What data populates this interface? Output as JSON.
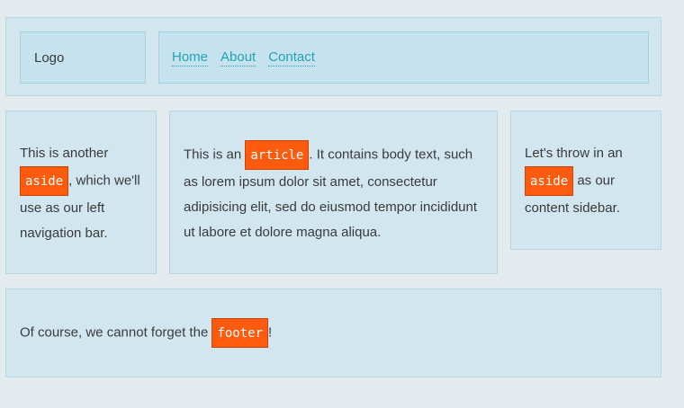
{
  "header": {
    "logo": "Logo",
    "nav": [
      {
        "label": "Home"
      },
      {
        "label": "About"
      },
      {
        "label": "Contact"
      }
    ]
  },
  "left_aside": {
    "text_before": "This is another ",
    "tag": "aside",
    "text_after": ", which we'll use as our left navigation bar."
  },
  "article": {
    "text_before": "This is an ",
    "tag": "article",
    "text_after": ". It contains body text, such as lorem ipsum dolor sit amet, consectetur adipisicing elit, sed do eiusmod tempor incididunt ut labore et dolore magna aliqua."
  },
  "right_aside": {
    "text_before": "Let's throw in an ",
    "tag": "aside",
    "text_after": " as our content sidebar."
  },
  "footer": {
    "text_before": "Of course, we cannot forget the ",
    "tag": "footer",
    "text_after": "!"
  },
  "colors": {
    "background": "#e3ebef",
    "panel": "#d2e6ef",
    "inner_box": "#c5e2ee",
    "link": "#22a3b3",
    "tag_bg": "#ff5b0f"
  }
}
